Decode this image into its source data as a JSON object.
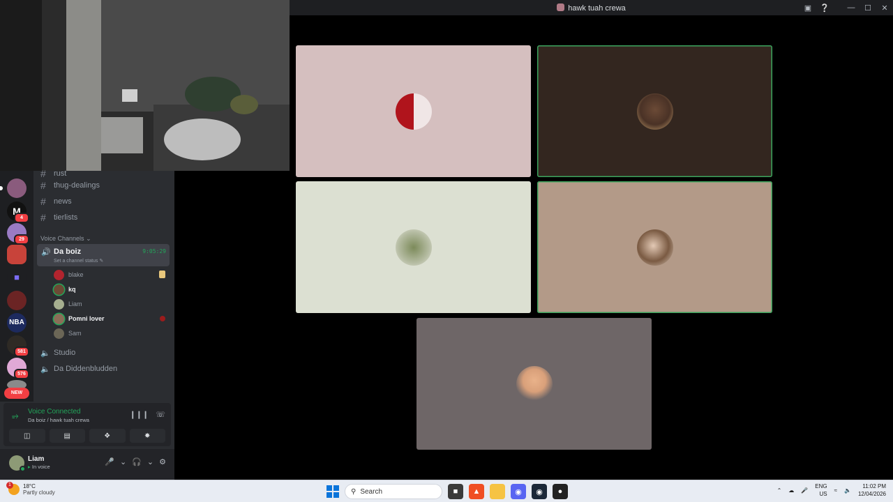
{
  "window": {
    "title": "hawk tuah crewa"
  },
  "camera": {
    "label": ""
  },
  "servers": [
    {
      "name": "server-1",
      "badge": ""
    },
    {
      "name": "server-2",
      "badge": "4"
    },
    {
      "name": "server-3",
      "badge": "29"
    },
    {
      "name": "server-4",
      "badge": ""
    },
    {
      "name": "server-5",
      "badge": ""
    },
    {
      "name": "server-6",
      "badge": ""
    },
    {
      "name": "server-7",
      "badge": ""
    },
    {
      "name": "server-8",
      "badge": "581"
    },
    {
      "name": "server-9",
      "badge": "576"
    },
    {
      "name": "server-10",
      "badge": ""
    }
  ],
  "new_pill": "NEW",
  "channels": {
    "text": [
      "rust",
      "thug-dealings",
      "news",
      "tierlists"
    ],
    "voice_category": "Voice Channels",
    "active_voice": {
      "name": "Da boiz",
      "timer": "9:05:29",
      "status_placeholder": "Set a channel status"
    },
    "members": [
      {
        "name": "blake",
        "bright": false
      },
      {
        "name": "kq",
        "bright": true
      },
      {
        "name": "Liam",
        "bright": false
      },
      {
        "name": "Pomni lover",
        "bright": true
      },
      {
        "name": "Sam",
        "bright": false
      }
    ],
    "other_voice": [
      "Studio",
      "Da Diddenbludden"
    ]
  },
  "voice_panel": {
    "status": "Voice Connected",
    "location": "Da boiz / hawk tuah crewa"
  },
  "user": {
    "name": "Liam",
    "status": "In voice"
  },
  "tiles": [
    {
      "name": "tile-1",
      "bg": "#d5bfbf",
      "speaking": false
    },
    {
      "name": "tile-2",
      "bg": "#33261f",
      "speaking": true
    },
    {
      "name": "tile-3",
      "bg": "#dce0d2",
      "speaking": false
    },
    {
      "name": "tile-4",
      "bg": "#b39a88",
      "speaking": true
    },
    {
      "name": "tile-5",
      "bg": "#6e6667",
      "speaking": false
    }
  ],
  "taskbar": {
    "temperature": "18°C",
    "weather": "Partly cloudy",
    "weather_badge": "1",
    "search_label": "Search",
    "lang1": "ENG",
    "lang2": "US",
    "time": "11:02 PM",
    "date": "12/04/2026"
  },
  "colors": {
    "discord_green": "#23a55a",
    "speaking_outline": "#3ba55d",
    "sidebar": "#2b2d31"
  }
}
